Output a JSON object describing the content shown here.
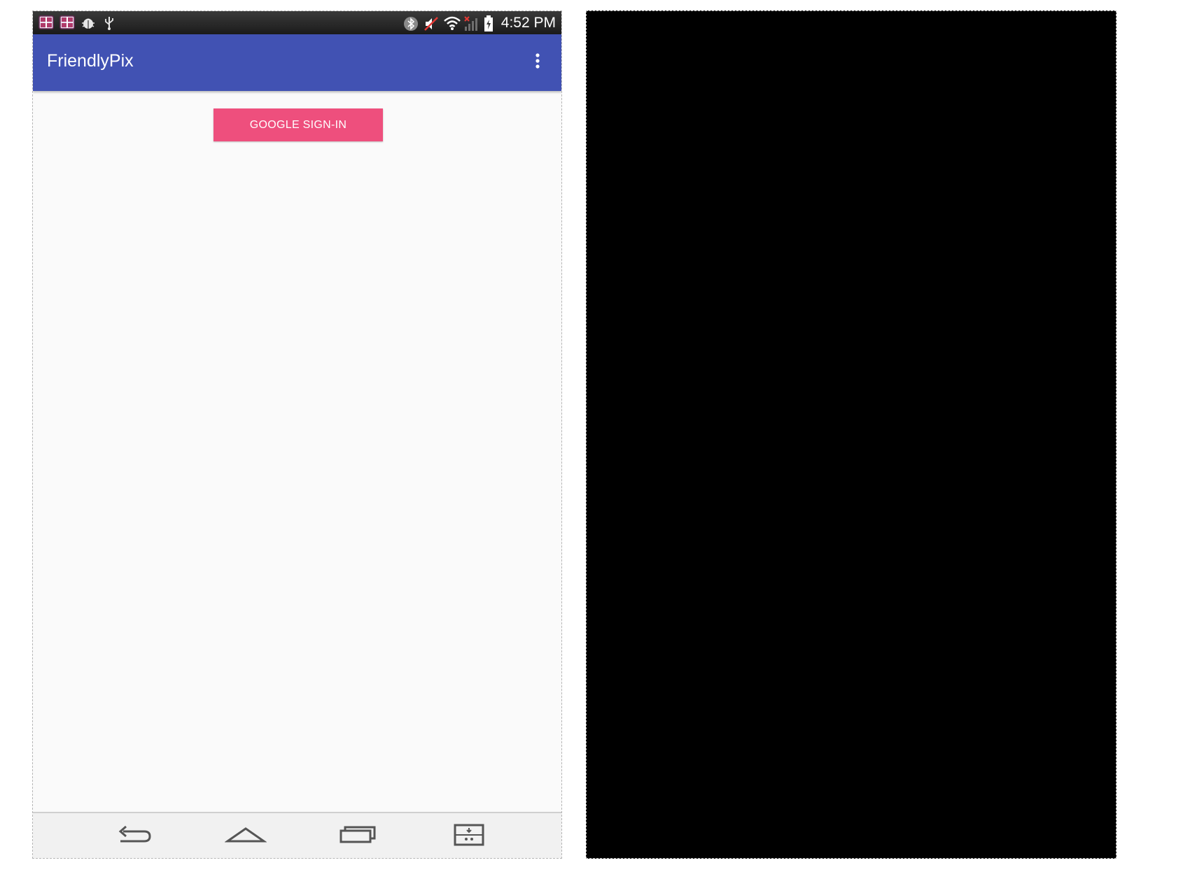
{
  "status_bar": {
    "time": "4:52 PM",
    "left_icons": [
      "gallery-notification-icon",
      "gallery-notification-icon",
      "android-debug-icon",
      "usb-icon"
    ],
    "right_icons": [
      "bluetooth-icon",
      "mute-icon",
      "wifi-icon",
      "no-signal-icon",
      "battery-charging-icon"
    ]
  },
  "app_bar": {
    "title": "FriendlyPix",
    "overflow_icon": "more-vert-icon",
    "color": "#4152b3"
  },
  "content": {
    "signin_button_label": "GOOGLE SIGN-IN",
    "signin_button_color": "#ee4f7d"
  },
  "nav_bar": {
    "buttons": [
      "back-icon",
      "home-icon",
      "recents-icon",
      "dual-window-icon"
    ]
  },
  "right_panel": {
    "color": "#000000"
  }
}
